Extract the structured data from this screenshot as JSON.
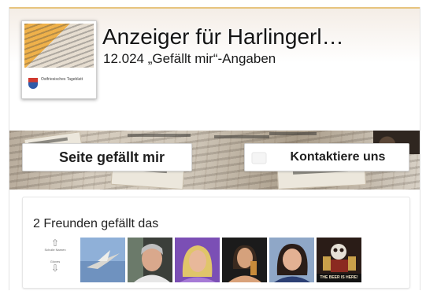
{
  "page": {
    "title": "Anzeiger für Harlingerl…",
    "likes_text": "12.024 „Gefällt mir“-Angaben",
    "profile_image": {
      "icon": "newspaper-logo-image",
      "brand_text": "Ostfriesisches Tageblatt"
    }
  },
  "actions": {
    "like_label": "Seite gefällt mir",
    "contact_label": "Kontaktiere uns",
    "contact_icon": "contact-icon"
  },
  "friends": {
    "text": "2 Freunden gefällt das",
    "scroll_up_label": "Scholle Namen",
    "scroll_down_label": "Gloves",
    "avatars": [
      {
        "icon": "bird-avatar"
      },
      {
        "icon": "man-avatar"
      },
      {
        "icon": "woman-blonde-avatar"
      },
      {
        "icon": "woman-dark-avatar"
      },
      {
        "icon": "woman-smiling-avatar"
      },
      {
        "icon": "beer-poster-avatar",
        "caption": "THE BEER IS HERE!"
      }
    ]
  },
  "colors": {
    "accent_line": "#e7c47e",
    "title_text": "#141414",
    "button_border": "#d3d3d3"
  }
}
